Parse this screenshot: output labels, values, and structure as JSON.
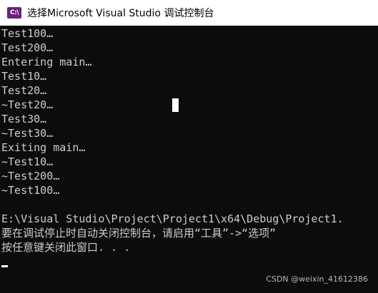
{
  "window": {
    "title": "选择Microsoft Visual Studio 调试控制台",
    "icon_label": "C:\\",
    "icon_name": "vs-debug-console-icon"
  },
  "console": {
    "lines": [
      "Test100…",
      "Test200…",
      "Entering main…",
      "Test10…",
      "Test20…",
      "~Test20…",
      "Test30…",
      "~Test30…",
      "Exiting main…",
      "~Test10…",
      "~Test200…",
      "~Test100…",
      "",
      "E:\\Visual Studio\\Project\\Project1\\x64\\Debug\\Project1.",
      "要在调试停止时自动关闭控制台，请启用“工具”->“选项”",
      "按任意键关闭此窗口. . ."
    ]
  },
  "watermark": {
    "text": "CSDN @weixin_41612386"
  },
  "colors": {
    "console_background": "#0c0c0c",
    "console_text": "#cccccc",
    "titlebar_background": "#ffffff",
    "icon_background": "#68217a"
  }
}
